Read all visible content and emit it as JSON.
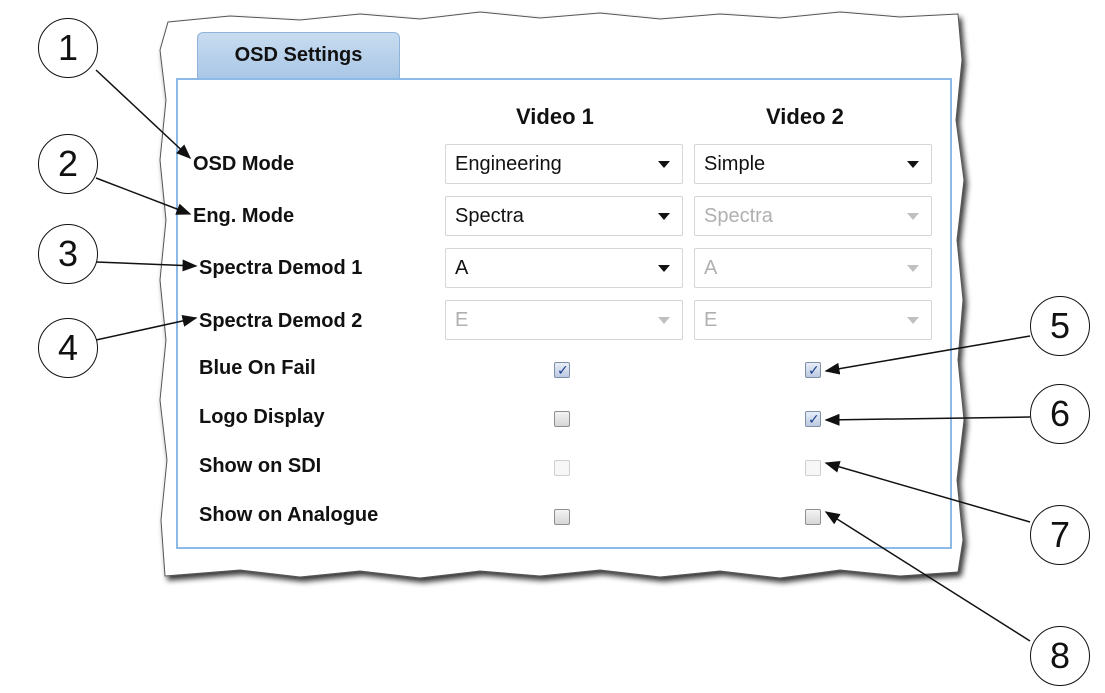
{
  "tab": {
    "label": "OSD Settings"
  },
  "columns": [
    "Video 1",
    "Video 2"
  ],
  "dropdown_rows": [
    {
      "label": "OSD Mode",
      "video1": {
        "value": "Engineering",
        "enabled": true
      },
      "video2": {
        "value": "Simple",
        "enabled": true
      }
    },
    {
      "label": "Eng. Mode",
      "video1": {
        "value": "Spectra",
        "enabled": true
      },
      "video2": {
        "value": "Spectra",
        "enabled": false
      }
    },
    {
      "label": "Spectra Demod 1",
      "video1": {
        "value": "A",
        "enabled": true
      },
      "video2": {
        "value": "A",
        "enabled": false
      }
    },
    {
      "label": "Spectra Demod 2",
      "video1": {
        "value": "E",
        "enabled": false
      },
      "video2": {
        "value": "E",
        "enabled": false
      }
    }
  ],
  "checkbox_rows": [
    {
      "label": "Blue On Fail",
      "video1": true,
      "video2": true
    },
    {
      "label": "Logo Display",
      "video1": false,
      "video2": true
    },
    {
      "label": "Show on SDI",
      "video1": false,
      "video2": false
    },
    {
      "label": "Show on Analogue",
      "video1": false,
      "video2": false
    }
  ],
  "callouts": [
    "1",
    "2",
    "3",
    "4",
    "5",
    "6",
    "7",
    "8"
  ]
}
